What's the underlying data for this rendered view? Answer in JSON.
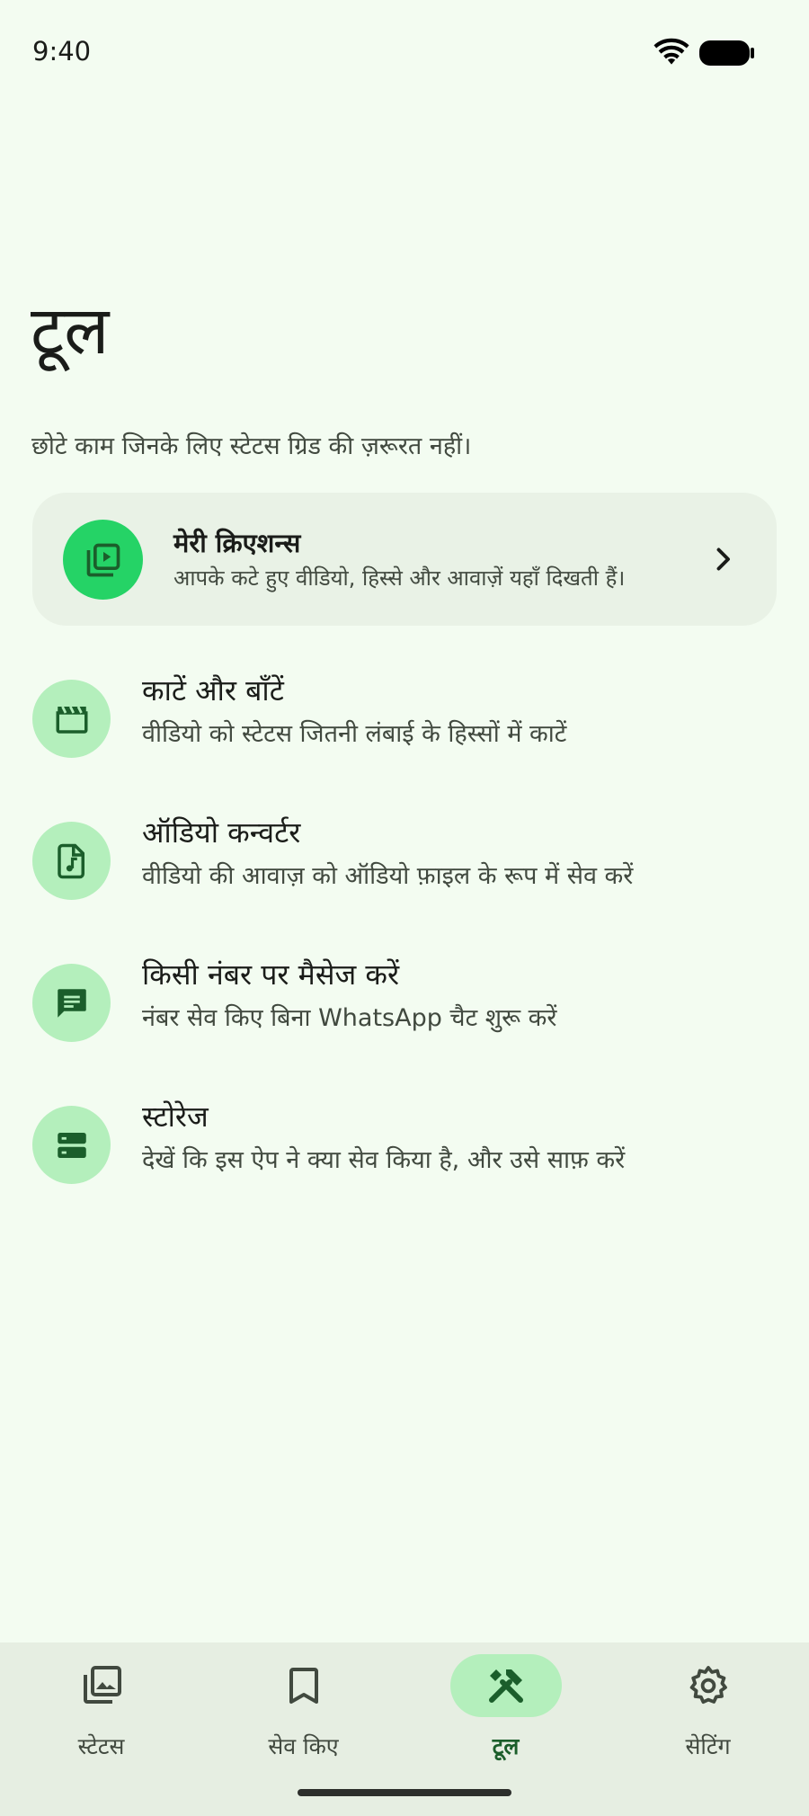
{
  "status_bar": {
    "time": "9:40"
  },
  "page": {
    "title": "टूल",
    "subtitle": "छोटे काम जिनके लिए स्टेटस ग्रिड की ज़रूरत नहीं।"
  },
  "creations": {
    "title": "मेरी क्रिएशन्स",
    "description": "आपके कटे हुए वीडियो, हिस्से और आवाज़ें यहाँ दिखती हैं।",
    "icon": "video-library-icon"
  },
  "tools": [
    {
      "title": "काटें और बाँटें",
      "description": "वीडियो को स्टेटस जितनी लंबाई के हिस्सों में काटें",
      "icon": "clapperboard-icon"
    },
    {
      "title": "ऑडियो कन्वर्टर",
      "description": "वीडियो की आवाज़ को ऑडियो फ़ाइल के रूप में सेव करें",
      "icon": "audio-file-icon"
    },
    {
      "title": "किसी नंबर पर मैसेज करें",
      "description": "नंबर सेव किए बिना WhatsApp चैट शुरू करें",
      "icon": "message-icon"
    },
    {
      "title": "स्टोरेज",
      "description": "देखें कि इस ऐप ने क्या सेव किया है, और उसे साफ़ करें",
      "icon": "storage-icon"
    }
  ],
  "bottom_nav": [
    {
      "label": "स्टेटस",
      "icon": "photo-library-icon",
      "active": false
    },
    {
      "label": "सेव किए",
      "icon": "bookmark-icon",
      "active": false
    },
    {
      "label": "टूल",
      "icon": "tools-icon",
      "active": true
    },
    {
      "label": "सेटिंग",
      "icon": "gear-icon",
      "active": false
    }
  ],
  "colors": {
    "background": "#f3fcf1",
    "accent": "#25d366",
    "tonal": "#b4efbc",
    "icon_dark": "#1b5e2b"
  }
}
